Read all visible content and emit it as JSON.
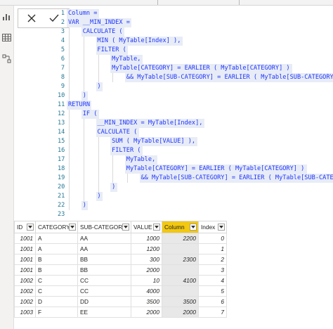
{
  "formula": {
    "cancel_icon": "close-icon",
    "commit_icon": "check-icon",
    "lines": [
      {
        "n": "1",
        "text": "Column ="
      },
      {
        "n": "2",
        "text": "VAR __MIN_INDEX ="
      },
      {
        "n": "3",
        "text": "    CALCULATE ("
      },
      {
        "n": "4",
        "text": "        MIN ( MyTable[Index] ),"
      },
      {
        "n": "5",
        "text": "        FILTER ("
      },
      {
        "n": "6",
        "text": "            MyTable,"
      },
      {
        "n": "7",
        "text": "            MyTable[CATEGORY] = EARLIER ( MyTable[CATEGORY] )"
      },
      {
        "n": "8",
        "text": "                && MyTable[SUB-CATEGORY] = EARLIER ( MyTable[SUB-CATEGORY] )"
      },
      {
        "n": "9",
        "text": "        )"
      },
      {
        "n": "10",
        "text": "    )"
      },
      {
        "n": "11",
        "text": "RETURN"
      },
      {
        "n": "12",
        "text": "    IF ("
      },
      {
        "n": "13",
        "text": "        __MIN_INDEX = MyTable[Index],"
      },
      {
        "n": "14",
        "text": "        CALCULATE ("
      },
      {
        "n": "15",
        "text": "            SUM ( MyTable[VALUE] ),"
      },
      {
        "n": "16",
        "text": "            FILTER ("
      },
      {
        "n": "17",
        "text": "                MyTable,"
      },
      {
        "n": "18",
        "text": "                MyTable[CATEGORY] = EARLIER ( MyTable[CATEGORY] )"
      },
      {
        "n": "19",
        "text": "                    && MyTable[SUB-CATEGORY] = EARLIER ( MyTable[SUB-CATEGORY] )"
      },
      {
        "n": "20",
        "text": "            )"
      },
      {
        "n": "21",
        "text": "        )"
      },
      {
        "n": "22",
        "text": "    )"
      },
      {
        "n": "23",
        "text": ""
      }
    ]
  },
  "table": {
    "columns": [
      "ID",
      "CATEGORY",
      "SUB-CATEGORY",
      "VALUE",
      "Column",
      "Index"
    ],
    "highlighted_column": "Column",
    "rows": [
      [
        "1001",
        "A",
        "AA",
        "1000",
        "2200",
        "0"
      ],
      [
        "1001",
        "A",
        "AA",
        "1200",
        "",
        "1"
      ],
      [
        "1001",
        "B",
        "BB",
        "300",
        "2300",
        "2"
      ],
      [
        "1001",
        "B",
        "BB",
        "2000",
        "",
        "3"
      ],
      [
        "1002",
        "C",
        "CC",
        "10",
        "4100",
        "4"
      ],
      [
        "1002",
        "C",
        "CC",
        "4000",
        "",
        "5"
      ],
      [
        "1002",
        "D",
        "DD",
        "3500",
        "3500",
        "6"
      ],
      [
        "1003",
        "F",
        "EE",
        "2000",
        "2000",
        "7"
      ]
    ]
  },
  "left_rail": {
    "icons": [
      "report-view-icon",
      "table-view-icon",
      "model-view-icon"
    ]
  }
}
